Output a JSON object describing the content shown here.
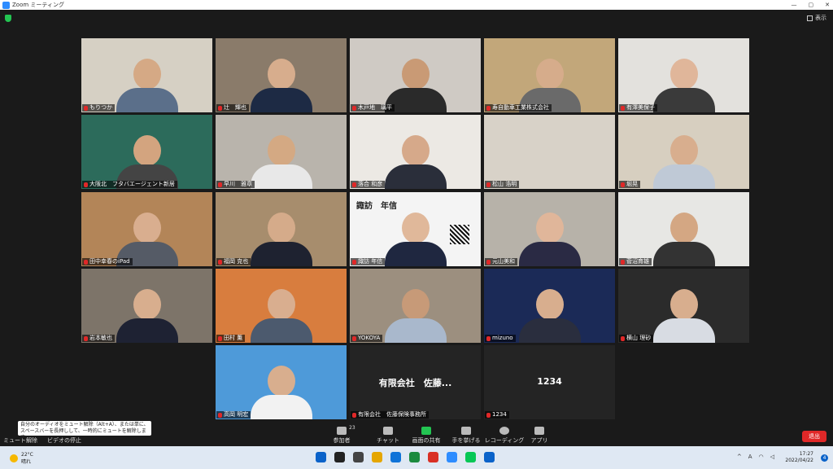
{
  "window": {
    "title": "Zoom ミーティング",
    "buttons": [
      "—",
      "▢",
      "✕"
    ]
  },
  "view_button": "表示",
  "participants": [
    {
      "name": "もりつか",
      "bg": "#d6d0c4",
      "skin": "#d5a985",
      "shirt": "#5b6f8a"
    },
    {
      "name": "辻　輝也",
      "bg": "#8a7b6a",
      "skin": "#d7ad8d",
      "shirt": "#1d2a44"
    },
    {
      "name": "木戸地　璃平",
      "bg": "#cfcac4",
      "skin": "#c99a75",
      "shirt": "#2a2a2a"
    },
    {
      "name": "寿自動車工業株式会社",
      "bg": "#c2a77a",
      "skin": "#d6ac8b",
      "shirt": "#6a6a6a"
    },
    {
      "name": "有澤美保子",
      "bg": "#e3e1dd",
      "skin": "#e0b69a",
      "shirt": "#3a3a3a"
    },
    {
      "name": "大阪北　フタバエージェント新居",
      "bg": "#2c6b5b",
      "skin": "#d3a47f",
      "shirt": "#444"
    },
    {
      "name": "早川　雅章",
      "bg": "#b9b4ac",
      "skin": "#d4a983",
      "shirt": "#e8e8e8"
    },
    {
      "name": "落合 和彦",
      "bg": "#ece9e4",
      "skin": "#d6a98a",
      "shirt": "#2a2e3a"
    },
    {
      "name": "松山 浩明",
      "bg": "#d8d2c8",
      "skin": "#d8d2c8",
      "shirt": "#d8d2c8"
    },
    {
      "name": "堀晃",
      "bg": "#d7cfc0",
      "skin": "#d8ae8e",
      "shirt": "#bfc9d6"
    },
    {
      "name": "田中幸春のiPad",
      "bg": "#b38558",
      "skin": "#d9ae8f",
      "shirt": "#555b66"
    },
    {
      "name": "福岡 克也",
      "bg": "#a78d6d",
      "skin": "#d5ab8a",
      "shirt": "#1e2230"
    },
    {
      "name": "諏訪 年信",
      "bg": "#f4f4f4",
      "skin": "#e0b89a",
      "shirt": "#1f2740"
    },
    {
      "name": "元山美和",
      "bg": "#b7b2a9",
      "skin": "#e0b69a",
      "shirt": "#2a2a44"
    },
    {
      "name": "菅沼育雄",
      "bg": "#e7e7e4",
      "skin": "#d4a783",
      "shirt": "#333"
    },
    {
      "name": "岩本敏也",
      "bg": "#7d7469",
      "skin": "#d8ae8e",
      "shirt": "#1e2233"
    },
    {
      "name": "田村 薫",
      "bg": "#d87d3e",
      "skin": "#d9ae8f",
      "shirt": "#4c5a6e",
      "active": true
    },
    {
      "name": "YOKOYA",
      "bg": "#9c8f7f",
      "skin": "#c79a78",
      "shirt": "#a9b8cc"
    },
    {
      "name": "mizuno",
      "bg": "#1b2a57",
      "skin": "#d8ae8e",
      "shirt": "#2a2e3e"
    },
    {
      "name": "横山 理砂",
      "bg": "#2b2b2b",
      "skin": "#d8ae8e",
      "shirt": "#d8dce3"
    },
    {
      "name": "高岡 明宏",
      "bg": "#4e9ad9",
      "skin": "#d8ae8e",
      "shirt": "#f2f2f2"
    },
    {
      "name": "有限会社　佐藤保険事務所",
      "center": "有限会社　佐藤..."
    },
    {
      "name": "1234",
      "center": "1234"
    }
  ],
  "slide": {
    "title": "諏訪　年信"
  },
  "toolbar": {
    "mute": "ミュート解除",
    "video": "ビデオの停止",
    "participants": "参加者",
    "participants_count": "23",
    "chat": "チャット",
    "share": "画面の共有",
    "raise": "手を挙げる",
    "record": "レコーディング",
    "apps": "アプリ",
    "leave": "退出"
  },
  "tooltip": "自分のオーディオをミュート解除（Alt+A）、または単に、スペースバーを長押しして、一時的にミュートを解除します。",
  "taskbar": {
    "temp": "22°C",
    "weather": "晴れ",
    "time": "17:27",
    "date": "2022/04/22",
    "badge": "4",
    "ime": "A",
    "icon_colors": [
      "#0a62c9",
      "#222",
      "#444",
      "#e5a600",
      "#0f73d8",
      "#1a8a3e",
      "#d93025",
      "#2d8cff",
      "#06c755",
      "#0a62c9"
    ]
  }
}
